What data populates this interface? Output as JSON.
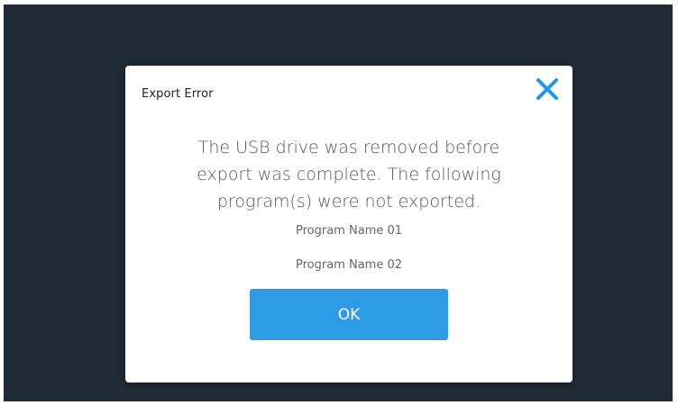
{
  "dialog": {
    "title": "Export Error",
    "close_icon": "close-icon",
    "message_line_1": "The USB drive was removed before",
    "message_line_2": "export was complete. The following",
    "message_line_3": "program(s) were not exported.",
    "programs": [
      "Program Name 01",
      "Program Name 02"
    ],
    "ok_label": "OK"
  },
  "colors": {
    "background": "#1f2a35",
    "dialog": "#ffffff",
    "accent": "#2d9be6",
    "close_icon": "#2196e8"
  }
}
